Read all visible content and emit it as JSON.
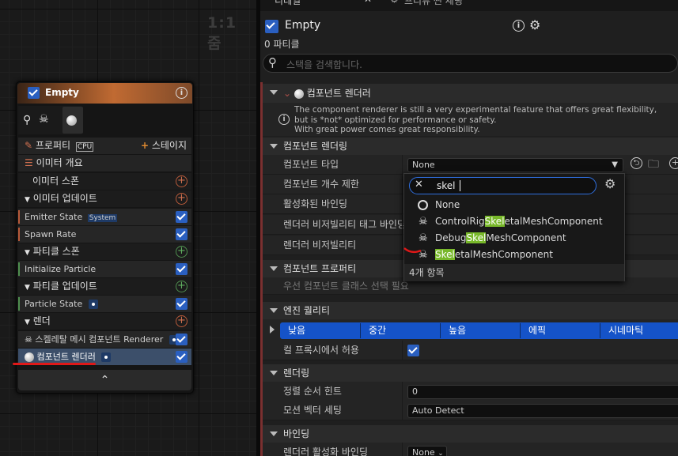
{
  "tabs": {
    "details": "디테일",
    "preview_settings": "프리뷰 씬 세팅"
  },
  "graph": {
    "zoom": "1:1 줌"
  },
  "node": {
    "title": "Empty",
    "properties_label": "프로퍼티",
    "cpu_badge": "CPU",
    "add_stage_label": "스테이지",
    "emitter_summary": "이미터 개요",
    "emitter_spawn": "이미터 스폰",
    "emitter_update": "이미터 업데이트",
    "emitter_state": "Emitter State",
    "system_badge": "System",
    "spawn_rate": "Spawn Rate",
    "particle_spawn": "파티클 스폰",
    "initialize_particle": "Initialize Particle",
    "particle_update": "파티클 업데이트",
    "particle_state": "Particle State",
    "render": "렌더",
    "skeletal_renderer": "스켈레탈 메시 컴포넌트 Renderer",
    "component_renderer": "컴포넌트 렌더러"
  },
  "details": {
    "title": "Empty",
    "particle_count": "0 파티클",
    "search_placeholder": "스택을 검색합니다.",
    "renderer_header": "컴포넌트 렌더러",
    "info_lines": [
      "The component renderer is still a very experimental feature that offers great flexibility,",
      "but is *not* optimized for performance or safety.",
      "With great power comes great responsibility."
    ],
    "sec_renderer": "컴포넌트 렌더링",
    "component_type": "컴포넌트 타입",
    "component_type_value": "None",
    "component_limit": "컴포넌트 개수 제한",
    "enabled_binding": "활성화된 바인딩",
    "visibility_tag_binding": "렌더러 비저빌리티 태그 바인딩",
    "renderer_visibility": "렌더러 비저빌리티",
    "sec_properties": "컴포넌트 프로퍼티",
    "select_class_hint": "우선 컴포넌트 클래스 선택 필요",
    "sec_quality": "엔진 퀄리티",
    "quality_levels": [
      "낮음",
      "중간",
      "높음",
      "에픽",
      "시네마틱"
    ],
    "allow_culling": "컬 프록시에서 허용",
    "sec_rendering": "렌더링",
    "sort_hint": "정렬 순서 힌트",
    "sort_hint_value": "0",
    "motion_vector": "모션 벡터 세팅",
    "motion_vector_value": "Auto Detect",
    "sec_binding": "바인딩",
    "renderer_enabled_binding": "렌더러 활성화 바인딩",
    "binding_value": "None"
  },
  "dropdown": {
    "search_value": "skel",
    "items": [
      {
        "pre": "",
        "hl": "",
        "post": "None"
      },
      {
        "pre": "ControlRig",
        "hl": "Skel",
        "post": "etalMeshComponent"
      },
      {
        "pre": "Debug",
        "hl": "Skel",
        "post": "MeshComponent"
      },
      {
        "pre": "",
        "hl": "Skel",
        "post": "etalMeshComponent"
      }
    ],
    "count": "4개 항목"
  },
  "colors": {
    "accent_blue": "#2a5fc0",
    "highlight_green": "#78b82a",
    "node_orange": "#c06a32"
  }
}
